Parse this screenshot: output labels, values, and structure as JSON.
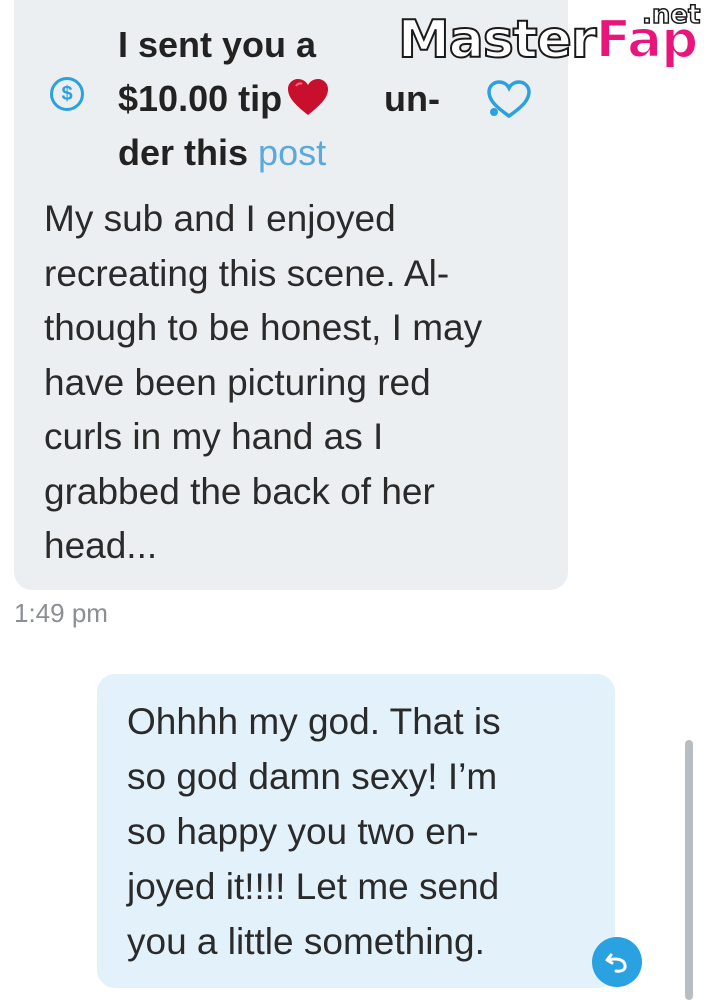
{
  "incoming": {
    "tip_lines": [
      "I sent you a",
      "$10.00 tip",
      "un-",
      "der this",
      "post"
    ],
    "dollar_symbol": "$",
    "message_lines": [
      "My sub and I enjoyed",
      "recreating this scene. Al-",
      "though to be honest, I may",
      "have been picturing red",
      "curls in my hand as I",
      "grabbed the back of her",
      "head..."
    ],
    "timestamp": "1:49 pm",
    "icons": [
      "dollar-circle-icon",
      "red-heart-icon",
      "outline-heart-icon"
    ]
  },
  "outgoing": {
    "message_lines": [
      "Ohhhh my god. That is",
      "so god damn sexy! I’m",
      "so happy you two en-",
      "joyed it!!!! Let me send",
      "you a little something."
    ],
    "icons": [
      "reply-icon"
    ]
  },
  "watermark": {
    "main": "Master",
    "accent": "Fap",
    "suffix": ".net"
  },
  "colors": {
    "incoming_bubble": "#eceff1",
    "outgoing_bubble": "#e3f1fb",
    "accent_blue": "#2aa1e0",
    "link_blue": "#5aa8dc",
    "heart_red": "#c8102e",
    "watermark_pink": "#e8157d"
  }
}
